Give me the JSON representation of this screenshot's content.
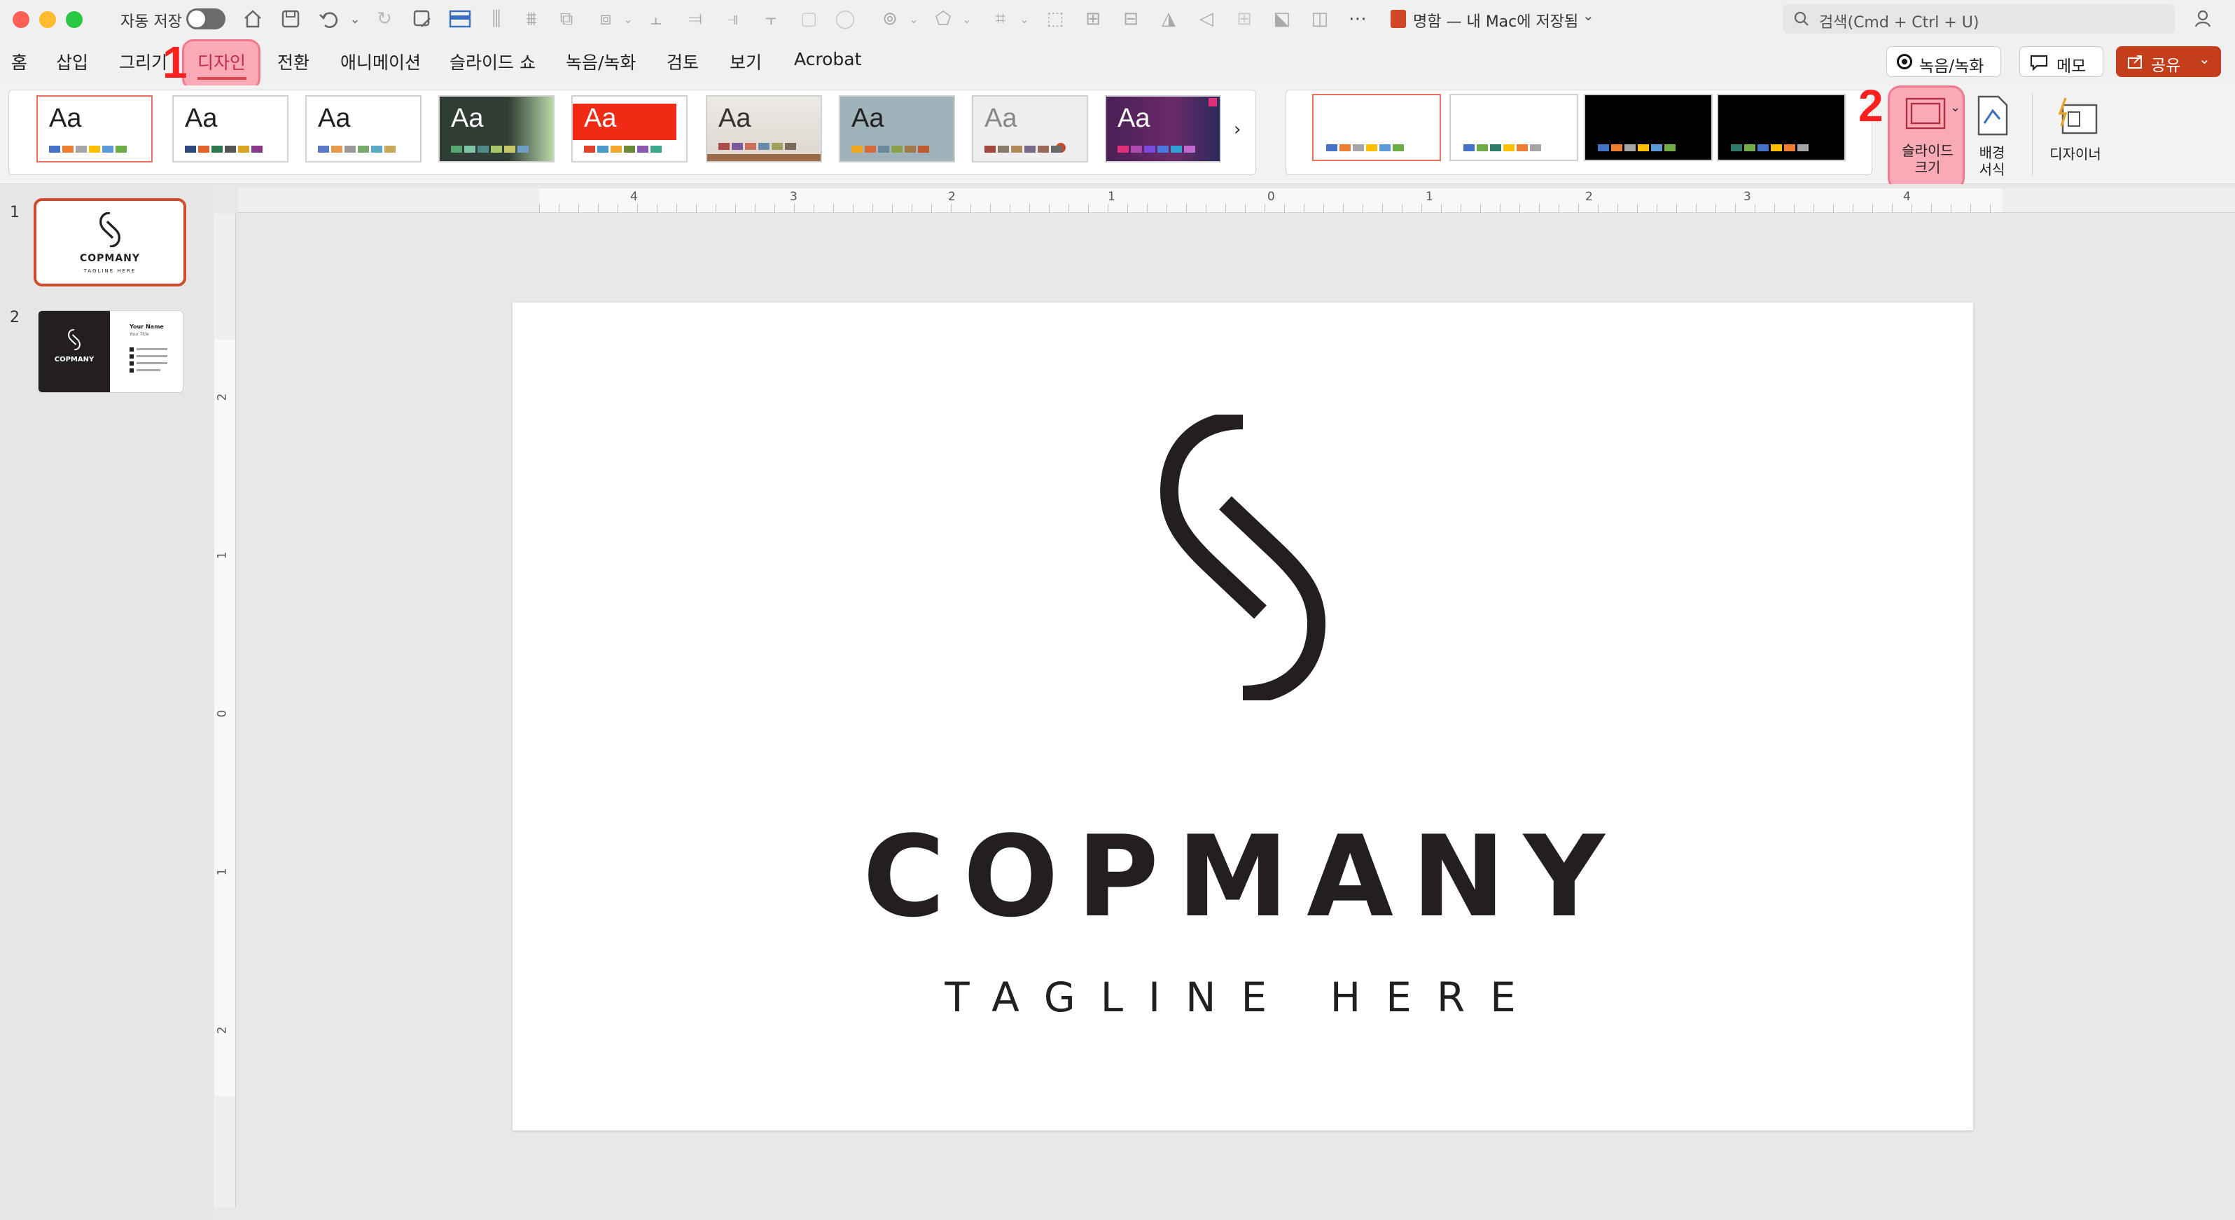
{
  "titlebar": {
    "autosave_label": "자동 저장",
    "doc_title": "명함 — 내 Mac에 저장됨",
    "search_placeholder": "검색(Cmd + Ctrl + U)"
  },
  "menu": {
    "tabs": [
      "홈",
      "삽입",
      "그리기",
      "디자인",
      "전환",
      "애니메이션",
      "슬라이드 쇼",
      "녹음/녹화",
      "검토",
      "보기",
      "Acrobat"
    ],
    "active_tab": "디자인",
    "record_button": "녹음/녹화",
    "memo_button": "메모",
    "share_button": "공유"
  },
  "annotations": {
    "step1": "1",
    "step2": "2",
    "highlight_color": "#f26d7d"
  },
  "ribbon": {
    "themes": [
      {
        "aa": "Aa",
        "bg": "#ffffff",
        "fg": "#222222"
      },
      {
        "aa": "Aa",
        "bg": "#ffffff",
        "fg": "#222222"
      },
      {
        "aa": "Aa",
        "bg": "#ffffff",
        "fg": "#222222"
      },
      {
        "aa": "Aa",
        "bg": "#2f3d35",
        "fg": "#ffffff"
      },
      {
        "aa": "Aa",
        "bg": "#ffffff",
        "fg": "#ffffff"
      },
      {
        "aa": "Aa",
        "bg": "#e8e4df",
        "fg": "#333333"
      },
      {
        "aa": "Aa",
        "bg": "#9fb0b8",
        "fg": "#222222"
      },
      {
        "aa": "Aa",
        "bg": "#e9e9e9",
        "fg": "#888888"
      },
      {
        "aa": "Aa",
        "bg": "#4a2450",
        "fg": "#ffffff"
      }
    ],
    "slide_size_label": "슬라이드\n크기",
    "background_format_label": "배경\n서식",
    "designer_label": "디자이너"
  },
  "thumbnails": [
    {
      "number": "1",
      "company": "COPMANY",
      "tagline": "TAGLINE HERE"
    },
    {
      "number": "2",
      "company": "COPMANY",
      "name": "Your Name",
      "title": "Your Title"
    }
  ],
  "ruler": {
    "top": [
      "4",
      "3",
      "2",
      "1",
      "0",
      "1",
      "2",
      "3",
      "4"
    ],
    "left": [
      "2",
      "1",
      "0",
      "1",
      "2"
    ]
  },
  "slide": {
    "company": "COPMANY",
    "tagline": "TAGLINE HERE"
  }
}
